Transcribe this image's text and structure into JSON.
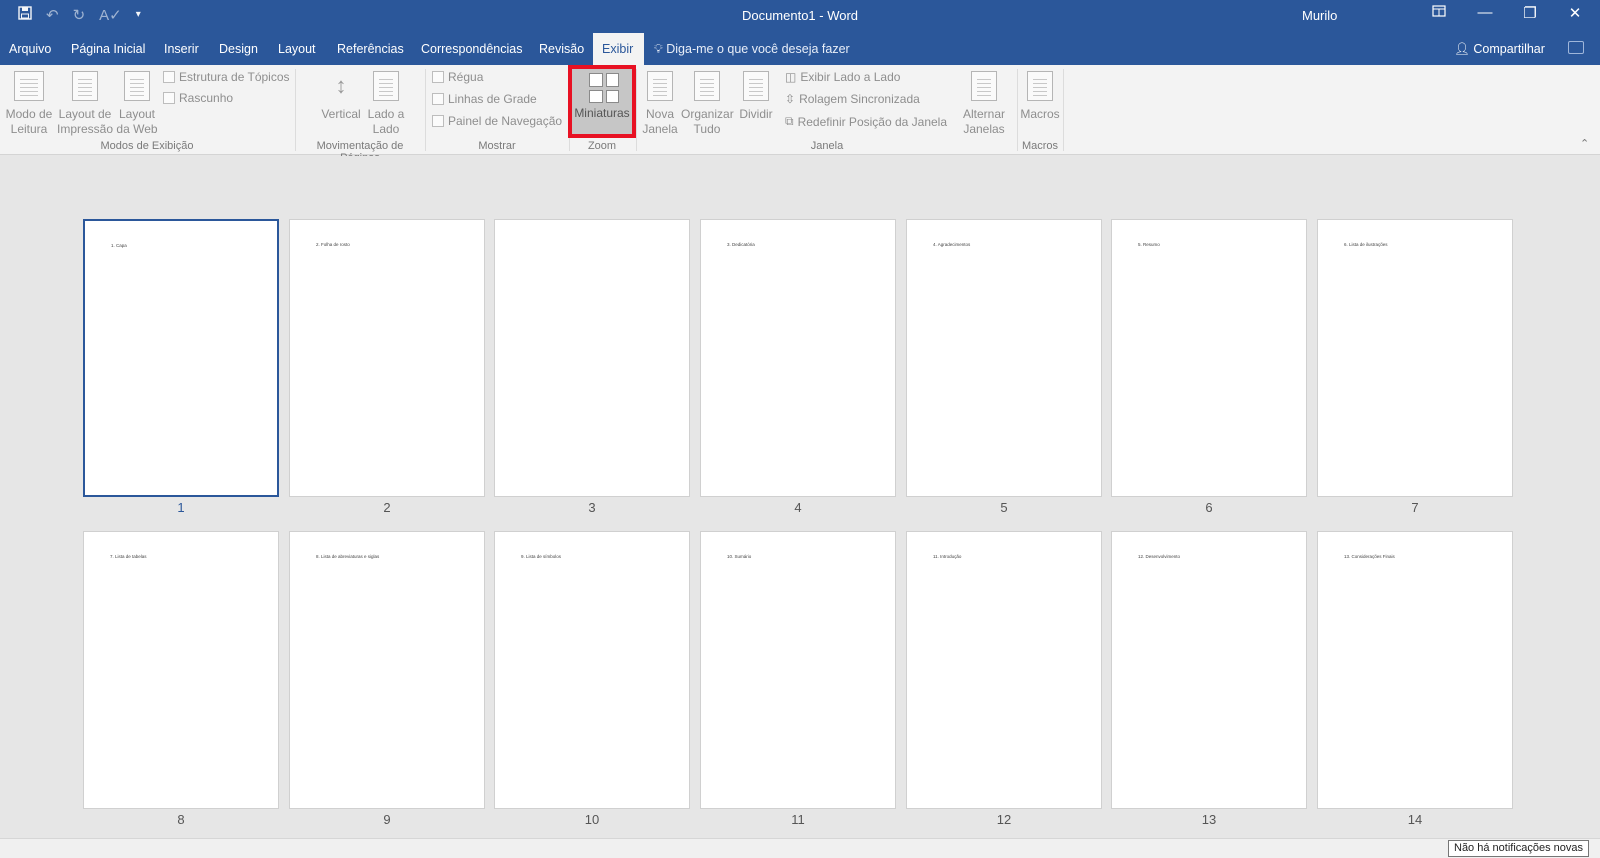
{
  "titlebar": {
    "title": "Documento1  -  Word",
    "user": "Murilo",
    "qat_icons": [
      "save-icon",
      "undo-icon",
      "redo-icon",
      "spelling-icon",
      "customize-qat-icon"
    ],
    "window_icons": [
      "ribbon-display-options-icon",
      "minimize-icon",
      "restore-icon",
      "close-icon"
    ]
  },
  "tabs": [
    "Arquivo",
    "Página Inicial",
    "Inserir",
    "Design",
    "Layout",
    "Referências",
    "Correspondências",
    "Revisão",
    "Exibir"
  ],
  "active_tab": "Exibir",
  "tellme": "Diga-me o que você deseja fazer",
  "share": "Compartilhar",
  "ribbon": {
    "views": {
      "group": "Modos de Exibição",
      "read_mode": "Modo de Leitura",
      "print_layout": "Layout de Impressão",
      "web_layout": "Layout da Web",
      "outline": "Estrutura de Tópicos",
      "draft": "Rascunho"
    },
    "page_movement": {
      "group": "Movimentação de Páginas",
      "vertical": "Vertical",
      "side_by_side": "Lado a Lado"
    },
    "show": {
      "group": "Mostrar",
      "ruler": "Régua",
      "gridlines": "Linhas de Grade",
      "nav_pane": "Painel de Navegação"
    },
    "zoom": {
      "group": "Zoom",
      "thumbnails": "Miniaturas"
    },
    "window": {
      "group": "Janela",
      "new_window": "Nova Janela",
      "arrange_all": "Organizar Tudo",
      "split": "Dividir",
      "view_side_by_side": "Exibir Lado a Lado",
      "sync_scroll": "Rolagem Sincronizada",
      "reset_position": "Redefinir Posição da Janela",
      "switch_windows": "Alternar Janelas"
    },
    "macros": {
      "group": "Macros",
      "macros": "Macros"
    }
  },
  "pages": [
    {
      "num": "1",
      "text": "1. Capa"
    },
    {
      "num": "2",
      "text": "2. Folha de rosto"
    },
    {
      "num": "3",
      "text": ""
    },
    {
      "num": "4",
      "text": "3. Dedicatória"
    },
    {
      "num": "5",
      "text": "4. Agradecimentos"
    },
    {
      "num": "6",
      "text": "5. Resumo"
    },
    {
      "num": "7",
      "text": "6. Lista de ilustrações"
    },
    {
      "num": "8",
      "text": "7. Lista de tabelas"
    },
    {
      "num": "9",
      "text": "8. Lista de abreviaturas e siglas"
    },
    {
      "num": "10",
      "text": "9. Lista de símbolos"
    },
    {
      "num": "11",
      "text": "10. Sumário"
    },
    {
      "num": "12",
      "text": "11. Introdução"
    },
    {
      "num": "13",
      "text": "12. Desenvolvimento"
    },
    {
      "num": "14",
      "text": "13. Considerações Finais"
    }
  ],
  "selected_page": "1",
  "status": {
    "notification": "Não há notificações novas"
  },
  "colors": {
    "brand": "#2b579a",
    "highlight": "#e81123"
  }
}
